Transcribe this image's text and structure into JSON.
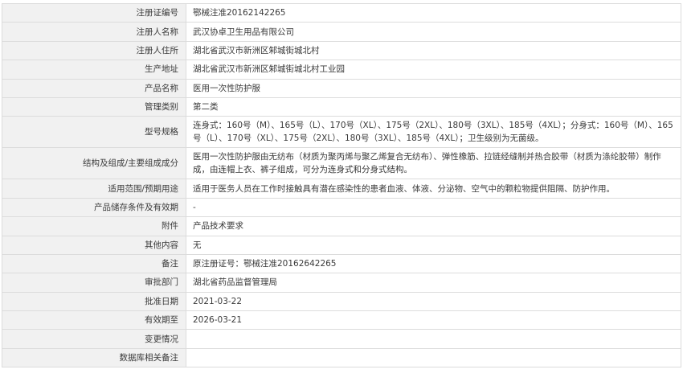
{
  "rows": [
    {
      "label": "注册证编号",
      "value": "鄂械注准20162142265"
    },
    {
      "label": "注册人名称",
      "value": "武汉协卓卫生用品有限公司"
    },
    {
      "label": "注册人住所",
      "value": "湖北省武汉市新洲区邾城街城北村"
    },
    {
      "label": "生产地址",
      "value": "湖北省武汉市新洲区邾城街城北村工业园"
    },
    {
      "label": "产品名称",
      "value": "医用一次性防护服"
    },
    {
      "label": "管理类别",
      "value": "第二类"
    },
    {
      "label": "型号规格",
      "value": "连身式：160号（M）、165号（L）、170号（XL）、175号（2XL）、180号（3XL）、185号（4XL）；分身式：160号（M）、165号（L）、170号（XL）、175号（2XL）、180号（3XL）、185号（4XL）；卫生级别为无菌级。"
    },
    {
      "label": "结构及组成/主要组成成分",
      "value": "医用一次性防护服由无纺布（材质为聚丙烯与聚乙烯复合无纺布）、弹性橡筋、拉链经缝制并热合胶带（材质为涤纶胶带）制作成，由连帽上衣、裤子组成，可分为连身式和分身式结构。"
    },
    {
      "label": "适用范围/预期用途",
      "value": "适用于医务人员在工作时接触具有潜在感染性的患者血液、体液、分泌物、空气中的颗粒物提供阻隔、防护作用。"
    },
    {
      "label": "产品储存条件及有效期",
      "value": "-"
    },
    {
      "label": "附件",
      "value": "产品技术要求"
    },
    {
      "label": "其他内容",
      "value": "无"
    },
    {
      "label": "备注",
      "value": "原注册证号：鄂械注准20162642265"
    },
    {
      "label": "审批部门",
      "value": "湖北省药品监督管理局"
    },
    {
      "label": "批准日期",
      "value": "2021-03-22"
    },
    {
      "label": "有效期至",
      "value": "2026-03-21"
    },
    {
      "label": "变更情况",
      "value": ""
    },
    {
      "label": "数据库相关备注",
      "value": ""
    }
  ]
}
